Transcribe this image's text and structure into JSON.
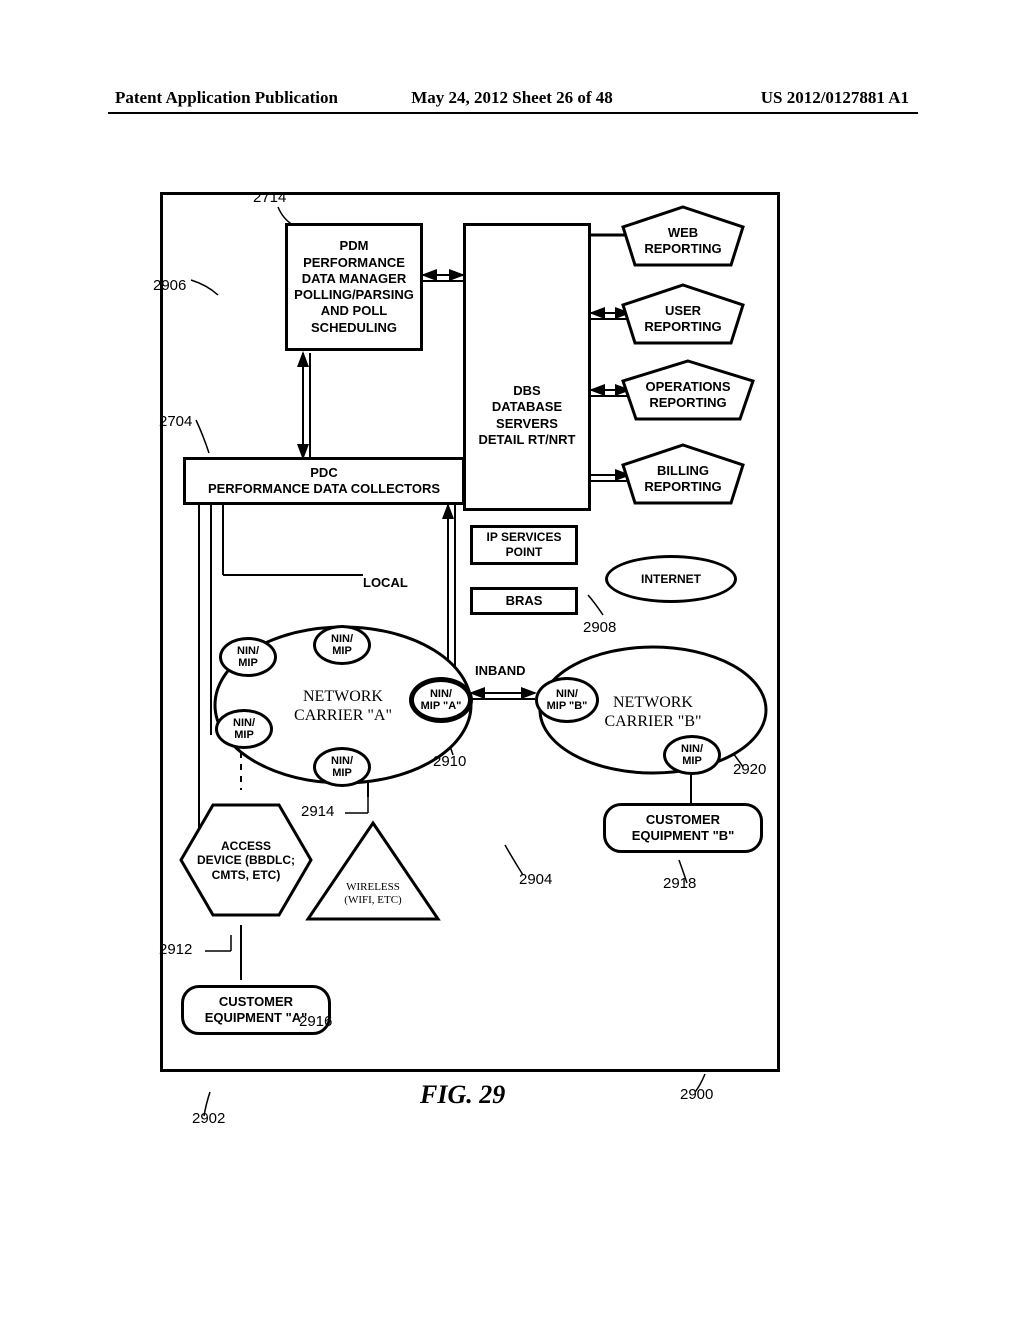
{
  "header": {
    "left": "Patent Application Publication",
    "mid": "May 24, 2012  Sheet 26 of 48",
    "right": "US 2012/0127881 A1"
  },
  "figure": {
    "caption": "FIG. 29"
  },
  "refs": {
    "r2714": "2714",
    "r2906": "2906",
    "r2704": "2704",
    "r2908": "2908",
    "r2910": "2910",
    "r2920": "2920",
    "r2904": "2904",
    "r2918": "2918",
    "r2914": "2914",
    "r2912": "2912",
    "r2916": "2916",
    "r2902": "2902",
    "r2900": "2900"
  },
  "blocks": {
    "pdm": "PDM\nPERFORMANCE\nDATA MANAGER\nPOLLING/PARSING\nAND POLL\nSCHEDULING",
    "pdc": "PDC\nPERFORMANCE DATA COLLECTORS",
    "dbs": "DBS\nDATABASE\nSERVERS\nDETAIL RT/NRT",
    "web_reporting": "WEB\nREPORTING",
    "user_reporting": "USER\nREPORTING",
    "ops_reporting": "OPERATIONS\nREPORTING",
    "billing_reporting": "BILLING\nREPORTING",
    "ip_services": "IP SERVICES\nPOINT",
    "bras": "BRAS",
    "internet": "INTERNET",
    "local_label": "LOCAL",
    "inband_label": "INBAND",
    "nin_mip": "NIN/\nMIP",
    "nin_mip_a": "NIN/\nMIP \"A\"",
    "nin_mip_b": "NIN/\nMIP \"B\"",
    "network_a": "NETWORK\nCARRIER \"A\"",
    "network_b": "NETWORK\nCARRIER \"B\"",
    "access_device": "ACCESS\nDEVICE (BBDLC;\nCMTS, ETC)",
    "wireless": "WIRELESS\n(WIFI, ETC)",
    "cust_a": "CUSTOMER\nEQUIPMENT \"A\"",
    "cust_b": "CUSTOMER\nEQUIPMENT \"B\""
  }
}
